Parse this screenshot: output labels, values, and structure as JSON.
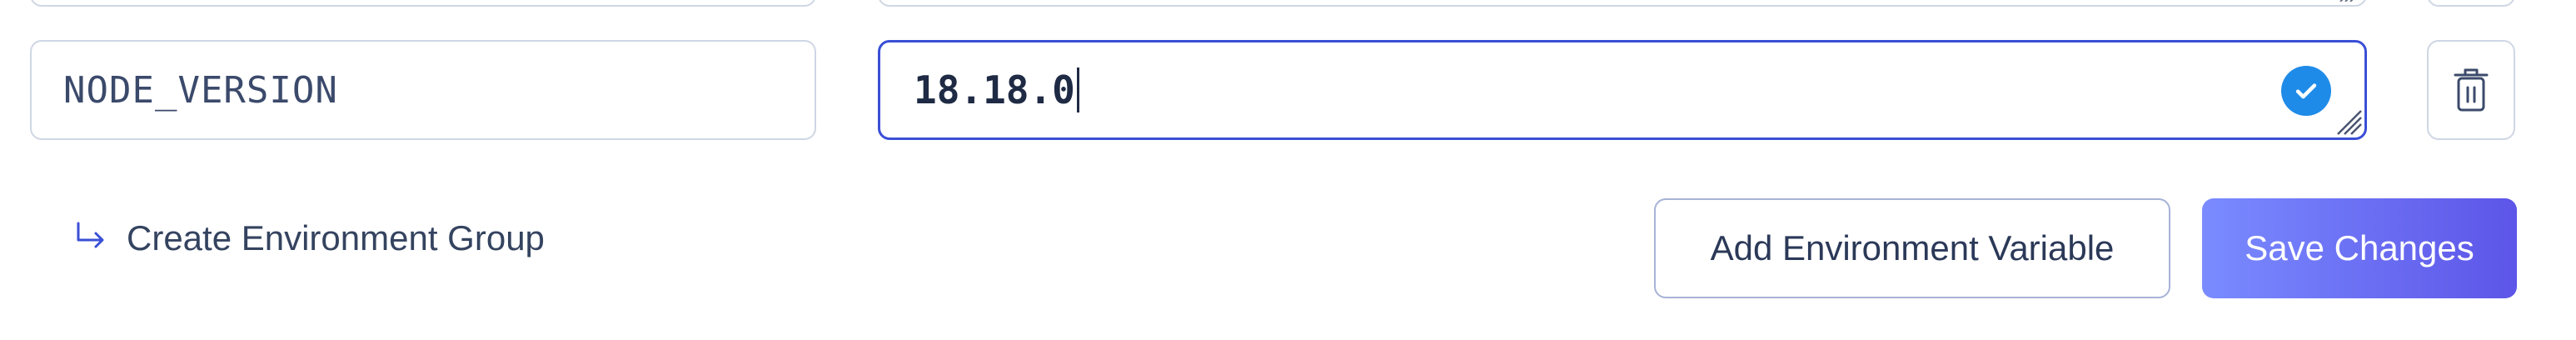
{
  "env_row": {
    "key": "NODE_VERSION",
    "value": "18.18.0"
  },
  "icons": {
    "check": "check-circle-icon",
    "resize": "resize-grip-icon",
    "delete": "trash-icon",
    "create_group": "arrow-turn-down-right-icon"
  },
  "actions": {
    "create_group_label": "Create Environment Group",
    "add_variable_label": "Add Environment Variable",
    "save_label": "Save Changes"
  },
  "colors": {
    "accent": "#3a4fd6",
    "check": "#1f8be8",
    "save_gradient_start": "#7a8bff",
    "save_gradient_end": "#5d55e8",
    "border": "#cfd6e4"
  }
}
